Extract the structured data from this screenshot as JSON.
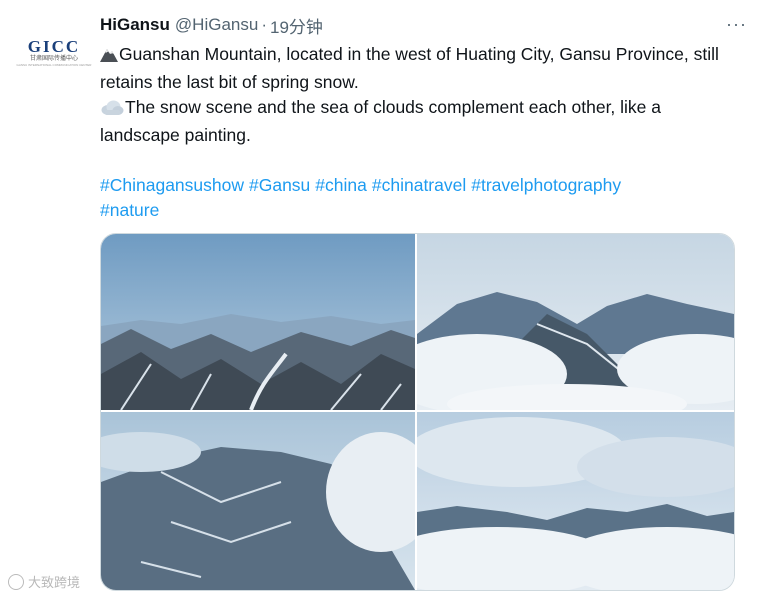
{
  "account": {
    "logo_text": "GICC",
    "logo_subtitle": "甘肃国际传播中心",
    "logo_tagline": "GANSU INTERNATIONAL COMMUNICATION CENTER",
    "name": "HiGansu",
    "handle": "@HiGansu",
    "separator": "·",
    "time": "19分钟"
  },
  "more_icon": "more-horizontal-icon",
  "tweet": {
    "line1_emoji": "mountain-icon",
    "line1": "Guanshan Mountain, located in the west of Huating City, Gansu Province, still retains the last bit of spring snow.",
    "line2_emoji": "cloud-icon",
    "line2": "The snow scene and the sea of clouds complement each other, like a landscape painting.",
    "hashtags": [
      "#Chinagansushow",
      "#Gansu",
      "#china",
      "#chinatravel",
      "#travelphotography",
      "#nature"
    ]
  },
  "media": [
    "mountain-valley-photo",
    "mountain-ridge-clouds-photo",
    "mountain-slope-clouds-photo",
    "sea-of-clouds-photo"
  ],
  "watermark": "大致跨境",
  "colors": {
    "link": "#1d9bf0",
    "secondary": "#536471",
    "border": "#cfd9de"
  }
}
